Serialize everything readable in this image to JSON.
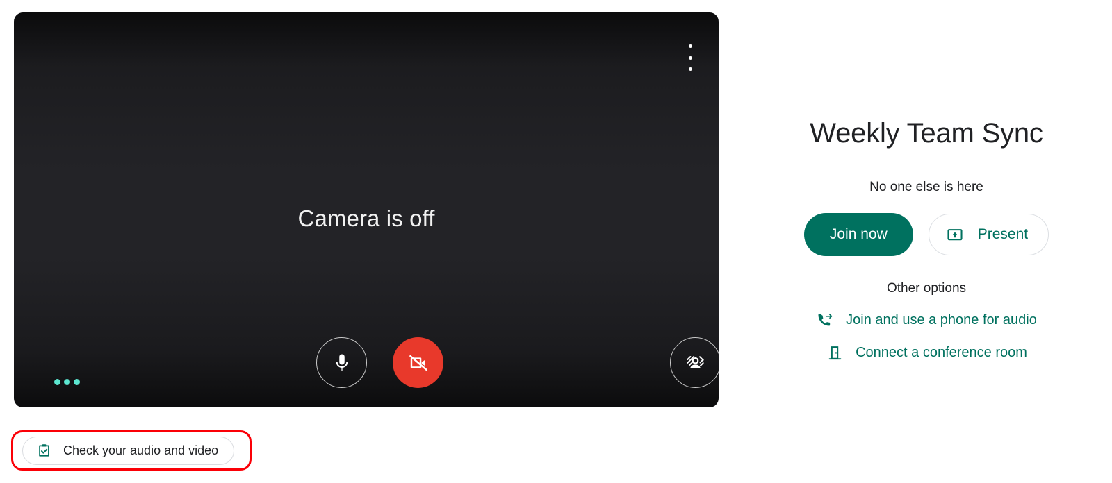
{
  "video_preview": {
    "camera_status_text": "Camera is off",
    "more_options_icon": "more-vert-icon",
    "audio_level_icon": "audio-level-dots-icon",
    "controls": [
      {
        "name": "microphone",
        "icon": "microphone-icon",
        "state": "on"
      },
      {
        "name": "camera",
        "icon": "camera-off-icon",
        "state": "off"
      },
      {
        "name": "visual-effects",
        "icon": "visual-effects-icon",
        "state": "off"
      }
    ]
  },
  "meeting": {
    "title": "Weekly Team Sync",
    "subtitle": "No one else is here",
    "join_label": "Join now",
    "present_label": "Present",
    "present_icon": "present-to-all-icon",
    "other_options_label": "Other options",
    "options": [
      {
        "label": "Join and use a phone for audio",
        "icon": "phone-forwarded-icon"
      },
      {
        "label": "Connect a conference room",
        "icon": "meeting-room-door-icon"
      }
    ]
  },
  "check_av": {
    "label": "Check your audio and video",
    "icon": "clipboard-check-icon"
  },
  "colors": {
    "accent_green": "#00715f",
    "danger_red": "#e8392b",
    "highlight_red": "#fb0007",
    "panel_dark": "#232327",
    "audio_dot": "#5ce6d0"
  }
}
